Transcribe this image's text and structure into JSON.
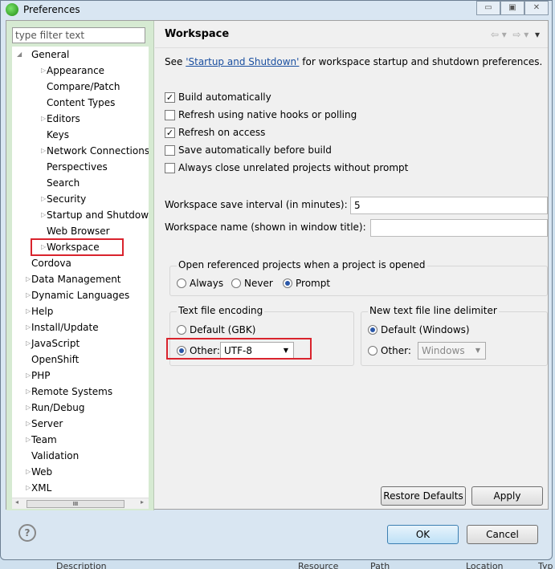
{
  "window": {
    "title": "Preferences",
    "controls": [
      "minimize",
      "maximize",
      "close"
    ]
  },
  "filter": {
    "placeholder": "type filter text"
  },
  "tree": [
    {
      "label": "General",
      "level": 0,
      "expanded": true
    },
    {
      "label": "Appearance",
      "level": 1,
      "arrow": true
    },
    {
      "label": "Compare/Patch",
      "level": 1
    },
    {
      "label": "Content Types",
      "level": 1
    },
    {
      "label": "Editors",
      "level": 1,
      "arrow": true
    },
    {
      "label": "Keys",
      "level": 1
    },
    {
      "label": "Network Connections",
      "level": 1,
      "arrow": true
    },
    {
      "label": "Perspectives",
      "level": 1
    },
    {
      "label": "Search",
      "level": 1
    },
    {
      "label": "Security",
      "level": 1,
      "arrow": true
    },
    {
      "label": "Startup and Shutdown",
      "level": 1,
      "arrow": true
    },
    {
      "label": "Web Browser",
      "level": 1
    },
    {
      "label": "Workspace",
      "level": 1,
      "arrow": true,
      "selected": true
    },
    {
      "label": "Cordova",
      "level": 0
    },
    {
      "label": "Data Management",
      "level": 0,
      "arrow": true
    },
    {
      "label": "Dynamic Languages",
      "level": 0,
      "arrow": true
    },
    {
      "label": "Help",
      "level": 0,
      "arrow": true
    },
    {
      "label": "Install/Update",
      "level": 0,
      "arrow": true
    },
    {
      "label": "JavaScript",
      "level": 0,
      "arrow": true
    },
    {
      "label": "OpenShift",
      "level": 0
    },
    {
      "label": "PHP",
      "level": 0,
      "arrow": true
    },
    {
      "label": "Remote Systems",
      "level": 0,
      "arrow": true
    },
    {
      "label": "Run/Debug",
      "level": 0,
      "arrow": true
    },
    {
      "label": "Server",
      "level": 0,
      "arrow": true
    },
    {
      "label": "Team",
      "level": 0,
      "arrow": true
    },
    {
      "label": "Validation",
      "level": 0
    },
    {
      "label": "Web",
      "level": 0,
      "arrow": true
    },
    {
      "label": "XML",
      "level": 0,
      "arrow": true
    }
  ],
  "page": {
    "title": "Workspace",
    "desc_pre": "See ",
    "desc_link": "'Startup and Shutdown'",
    "desc_post": " for workspace startup and shutdown preferences.",
    "checks": [
      {
        "label": "Build automatically",
        "checked": true
      },
      {
        "label": "Refresh using native hooks or polling",
        "checked": false
      },
      {
        "label": "Refresh on access",
        "checked": true
      },
      {
        "label": "Save automatically before build",
        "checked": false
      },
      {
        "label": "Always close unrelated projects without prompt",
        "checked": false
      }
    ],
    "save_interval_label": "Workspace save interval (in minutes):",
    "save_interval": "5",
    "name_label": "Workspace name (shown in window title):",
    "name_value": "",
    "open_group": {
      "title": "Open referenced projects when a project is opened",
      "options": [
        "Always",
        "Never",
        "Prompt"
      ],
      "selected": "Prompt"
    },
    "encoding": {
      "title": "Text file encoding",
      "default": "Default (GBK)",
      "other": "Other:",
      "value": "UTF-8",
      "selected": "Other"
    },
    "delimiter": {
      "title": "New text file line delimiter",
      "default": "Default (Windows)",
      "other": "Other:",
      "value": "Windows",
      "selected": "Default"
    },
    "restore": "Restore Defaults",
    "apply": "Apply"
  },
  "footer": {
    "ok": "OK",
    "cancel": "Cancel",
    "help": "?"
  },
  "background": {
    "columns": [
      "Description",
      "Resource",
      "Path",
      "Location",
      "Typ"
    ]
  },
  "colors": {
    "highlight": "#d9232d",
    "sidebar": "#d6ead2"
  }
}
